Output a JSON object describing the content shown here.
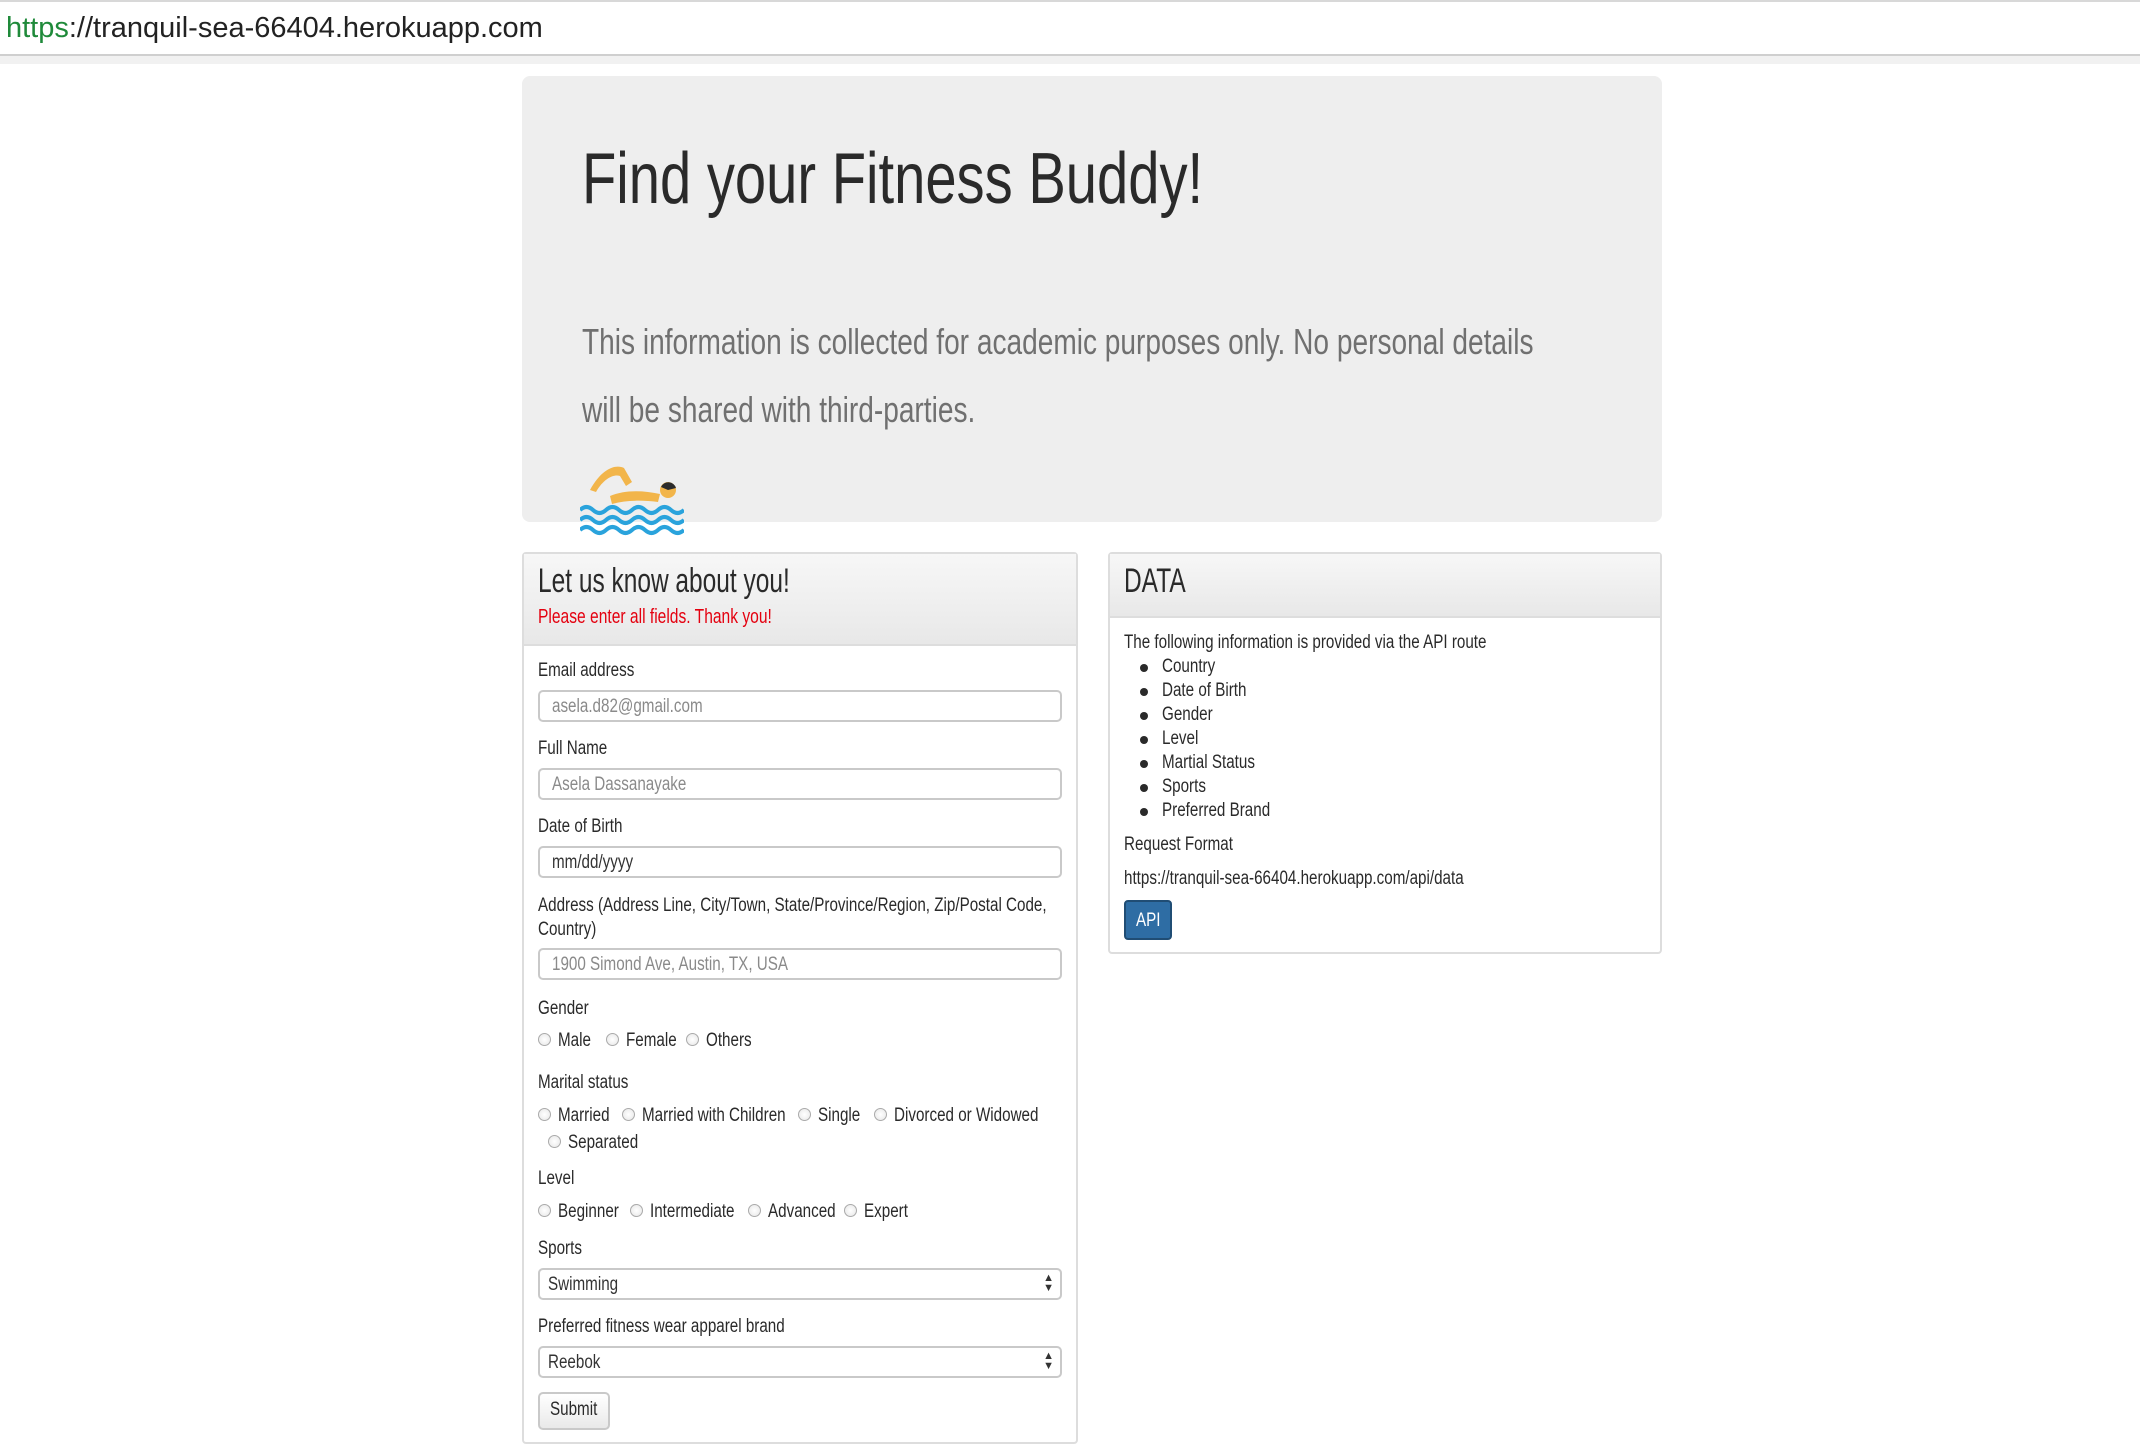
{
  "browser": {
    "url_scheme": "https",
    "url_rest": "://tranquil-sea-66404.herokuapp.com"
  },
  "jumbotron": {
    "title": "Find your Fitness Buddy!",
    "lead": "This information is collected for academic purposes only. No personal details will be shared with third-parties.",
    "emoji": "swimmer-emoji"
  },
  "form": {
    "title": "Let us know about you!",
    "subtitle": "Please enter all fields. Thank you!",
    "email": {
      "label": "Email address",
      "placeholder": "asela.d82@gmail.com"
    },
    "fullname": {
      "label": "Full Name",
      "placeholder": "Asela Dassanayake"
    },
    "dob": {
      "label": "Date of Birth",
      "placeholder": "mm/dd/yyyy"
    },
    "address": {
      "label": "Address (Address Line, City/Town, State/Province/Region, Zip/Postal Code, Country)",
      "placeholder": "1900 Simond Ave, Austin, TX, USA"
    },
    "gender": {
      "label": "Gender",
      "options": [
        "Male",
        "Female",
        "Others"
      ]
    },
    "marital": {
      "label": "Marital status",
      "options": [
        "Married",
        "Married with Children",
        "Single",
        "Divorced or Widowed",
        "Separated"
      ]
    },
    "level": {
      "label": "Level",
      "options": [
        "Beginner",
        "Intermediate",
        "Advanced",
        "Expert"
      ]
    },
    "sports": {
      "label": "Sports",
      "selected": "Swimming"
    },
    "brand": {
      "label": "Preferred fitness wear apparel brand",
      "selected": "Reebok"
    },
    "submit_label": "Submit"
  },
  "data_panel": {
    "title": "DATA",
    "intro": "The following information is provided via the API route",
    "items": [
      "Country",
      "Date of Birth",
      "Gender",
      "Level",
      "Martial Status",
      "Sports",
      "Preferred Brand"
    ],
    "request_format_label": "Request Format",
    "request_url": "https://tranquil-sea-66404.herokuapp.com/api/data",
    "api_button_label": "API"
  },
  "colors": {
    "jumbotron_bg": "#eeeeee",
    "required_text": "#e4000f",
    "primary_button": "#2e6da4",
    "secure_scheme": "#1f8a3a"
  }
}
